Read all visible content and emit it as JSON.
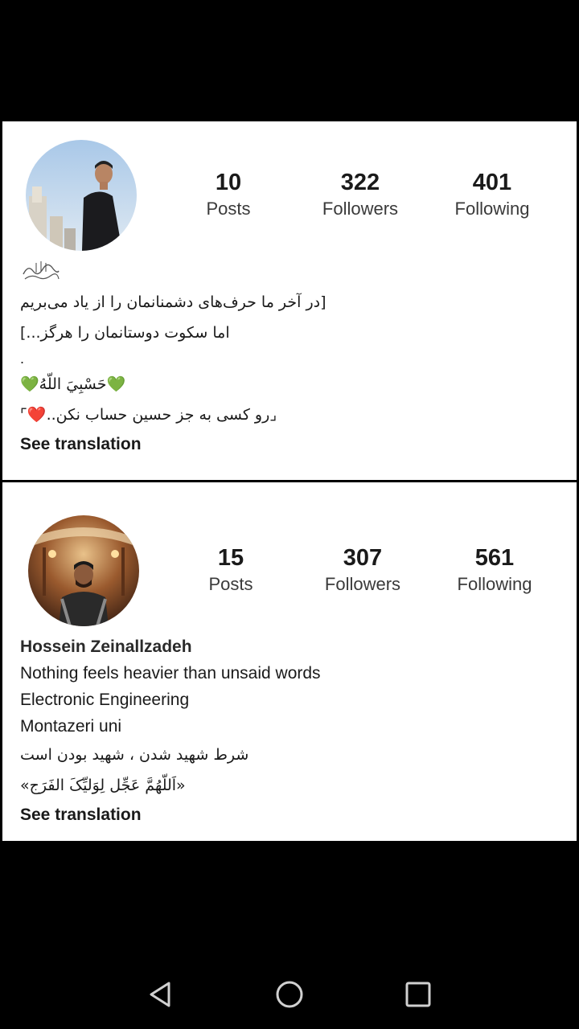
{
  "profile1": {
    "stats": [
      {
        "value": "10",
        "label": "Posts"
      },
      {
        "value": "322",
        "label": "Followers"
      },
      {
        "value": "401",
        "label": "Following"
      }
    ],
    "bio": {
      "line1": "[در آخر ما حرف‌های دشمنانمان را از یاد می‌بریم",
      "line2": "اما سکوت دوستانمان را هرگز...]",
      "line3": ".",
      "line4": "💚حَسْبِيَ اللّهُ💚",
      "line5": "⌟رو کسی به جز حسین حساب نکن..❤️⌜"
    },
    "see_translation": "See translation"
  },
  "profile2": {
    "stats": [
      {
        "value": "15",
        "label": "Posts"
      },
      {
        "value": "307",
        "label": "Followers"
      },
      {
        "value": "561",
        "label": "Following"
      }
    ],
    "bio": {
      "name": "Hossein Zeinallzadeh",
      "line1": "Nothing feels heavier than unsaid words",
      "line2": "Electronic Engineering",
      "line3": "Montazeri uni",
      "line4": "شرط شهید شدن ، شهید بودن است",
      "line5": "«اَللّهُمَّ عَجِّل لِوَلیِّکَ الفَرَج»"
    },
    "see_translation": "See translation"
  },
  "navbar": {
    "icons": [
      "back-icon",
      "home-icon",
      "recent-apps-icon"
    ]
  }
}
